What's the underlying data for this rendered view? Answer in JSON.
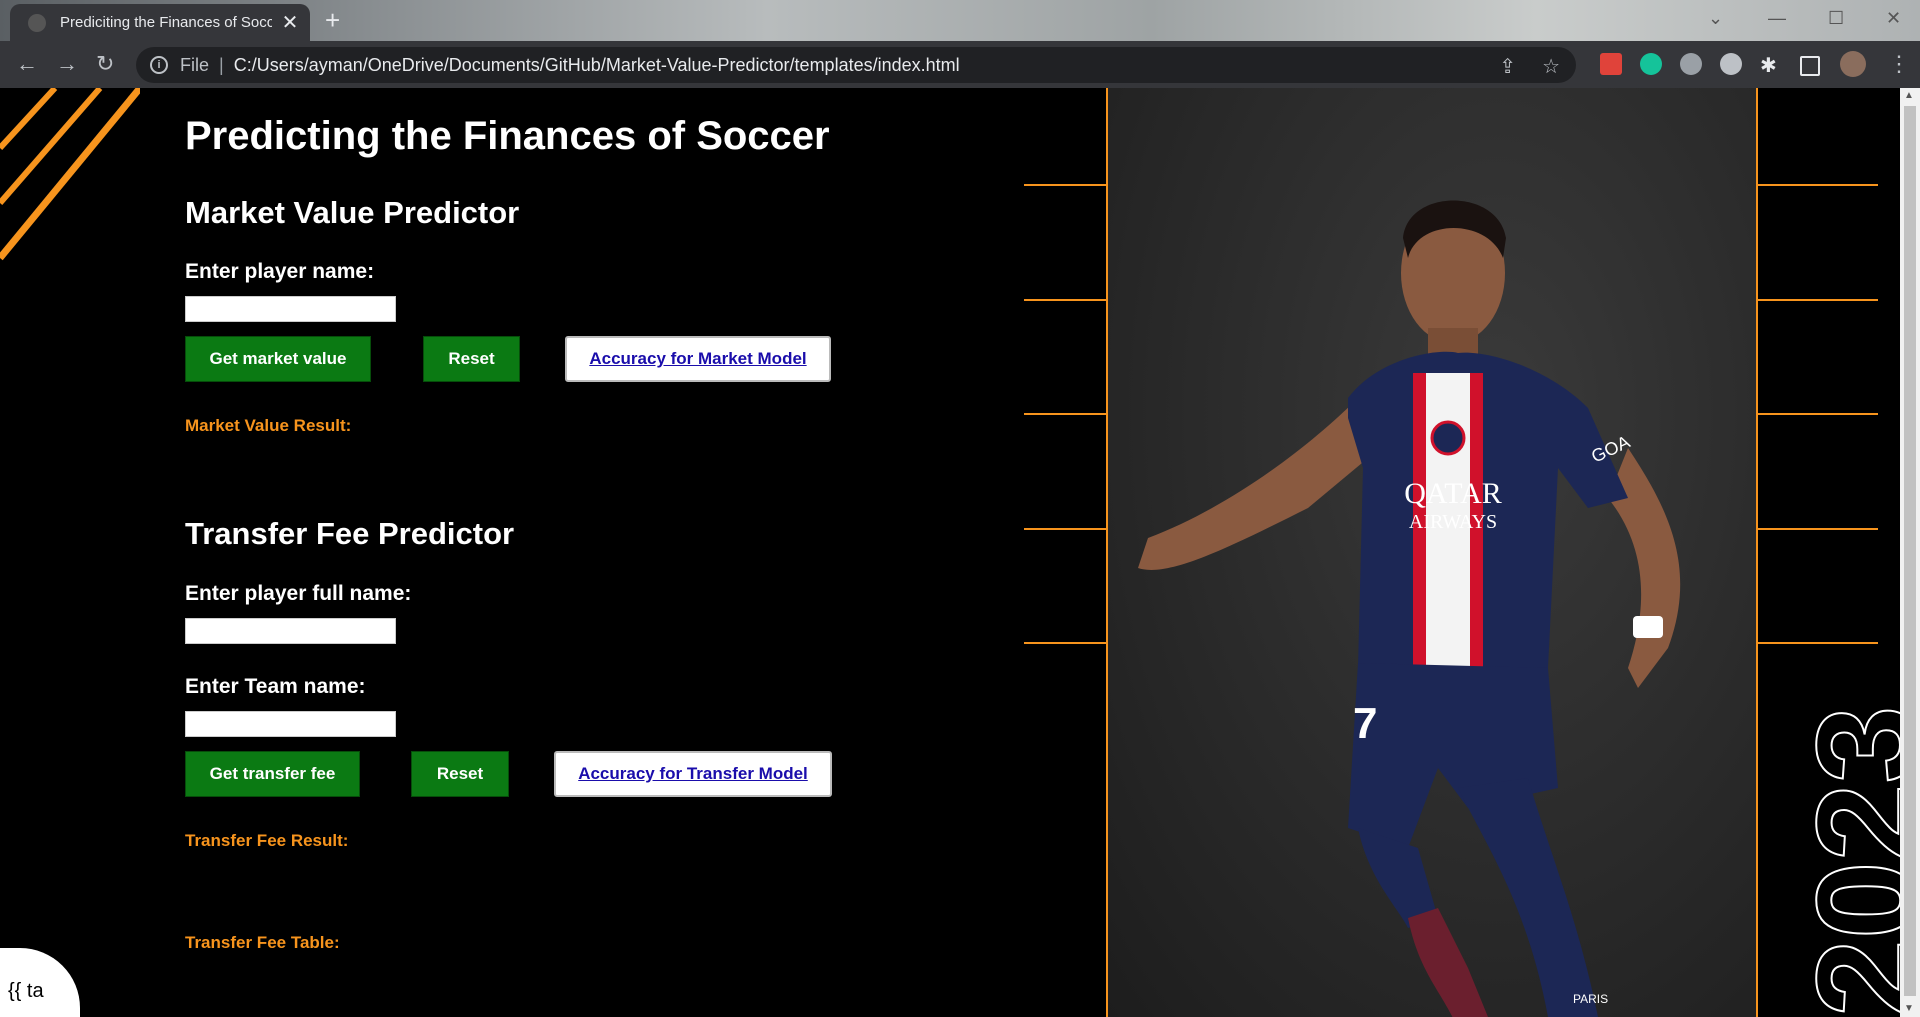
{
  "browser": {
    "tab_title": "Prediciting the Finances of Soccer",
    "tab_close": "✕",
    "new_tab": "+",
    "address_scheme_label": "File",
    "address_url": "C:/Users/ayman/OneDrive/Documents/GitHub/Market-Value-Predictor/templates/index.html"
  },
  "page": {
    "title": "Predicting the Finances of Soccer",
    "market": {
      "heading": "Market Value Predictor",
      "player_label": "Enter player name:",
      "player_value": "",
      "get_button": "Get market value",
      "reset_button": "Reset",
      "accuracy_link": "Accuracy for Market Model",
      "result_label": "Market Value Result:"
    },
    "transfer": {
      "heading": "Transfer Fee Predictor",
      "player_label": "Enter player full name:",
      "player_value": "",
      "team_label": "Enter Team name:",
      "team_value": "",
      "get_button": "Get transfer fee",
      "reset_button": "Reset",
      "accuracy_link": "Accuracy for Transfer Model",
      "result_label": "Transfer Fee Result:",
      "table_label": "Transfer Fee Table:"
    },
    "template_placeholder": "{{ ta",
    "year_text": "2023",
    "player_jersey": {
      "sponsor_line1": "QATAR",
      "sponsor_line2": "AIRWAYS",
      "number": "7",
      "sleeve": "GOA",
      "shorts": "PARIS"
    }
  },
  "colors": {
    "accent_orange": "#f7941d",
    "button_green": "#0b7a13",
    "link_blue": "#1a0dab",
    "jersey_navy": "#1c2755",
    "jersey_red": "#d0112b"
  }
}
